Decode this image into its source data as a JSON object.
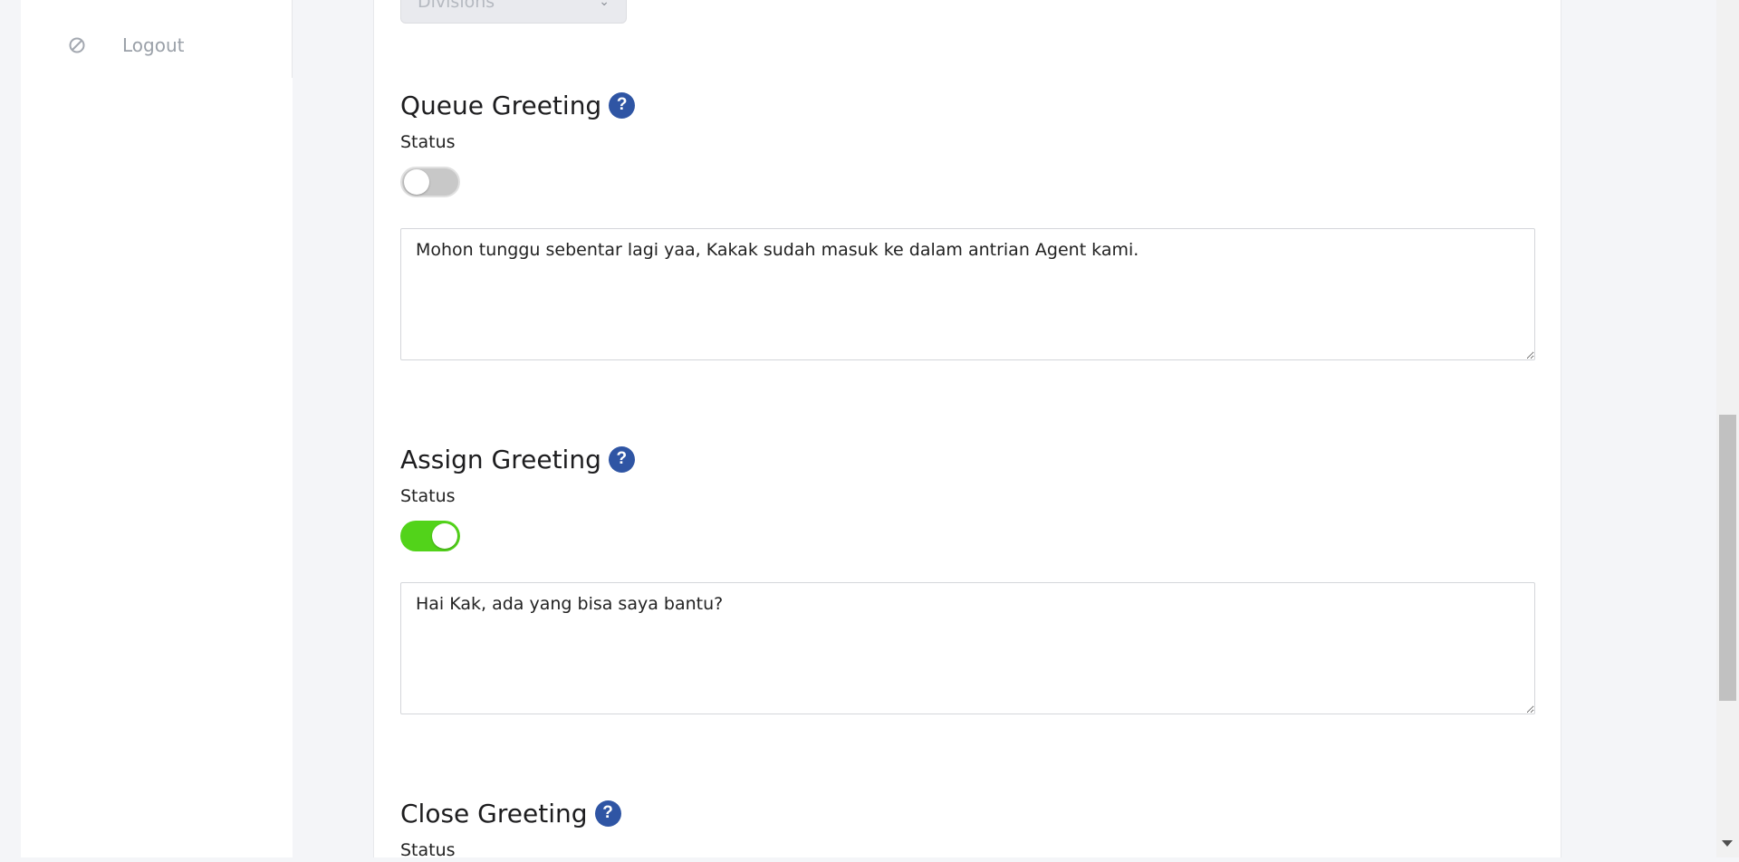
{
  "sidebar": {
    "logout": {
      "label": "Logout",
      "icon": "ban-icon"
    }
  },
  "divisions": {
    "label": "Divisions"
  },
  "queue_greeting": {
    "title": "Queue Greeting",
    "status_label": "Status",
    "enabled": false,
    "message": "Mohon tunggu sebentar lagi yaa, Kakak sudah masuk ke dalam antrian Agent kami."
  },
  "assign_greeting": {
    "title": "Assign Greeting",
    "status_label": "Status",
    "enabled": true,
    "message": "Hai Kak, ada yang bisa saya bantu?"
  },
  "close_greeting": {
    "title": "Close Greeting",
    "status_label": "Status"
  },
  "help_glyph": "?",
  "colors": {
    "toggle_on": "#52d31a",
    "toggle_off": "#c8c8c8",
    "help_icon": "#2f55a4"
  }
}
